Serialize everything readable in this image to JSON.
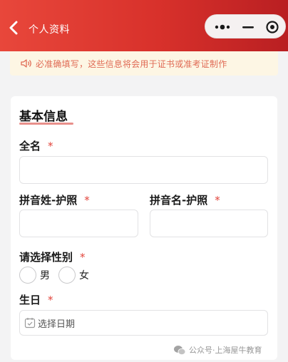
{
  "header": {
    "title": "个人资料",
    "gradient_start": "#e8473b",
    "gradient_end": "#b91f22"
  },
  "capsule": {
    "icons": [
      "more-icon",
      "minimize-icon",
      "close-circle-icon"
    ]
  },
  "notice": {
    "text": "必准确填写，这些信息将会用于证书或准考证制作",
    "icon": "speaker-icon"
  },
  "form": {
    "section_title": "基本信息",
    "required_mark": "*",
    "full_name": {
      "label": "全名",
      "value": ""
    },
    "pinyin_surname": {
      "label": "拼音姓-护照",
      "value": ""
    },
    "pinyin_given": {
      "label": "拼音名-护照",
      "value": ""
    },
    "gender": {
      "label": "请选择性别",
      "options": [
        "男",
        "女"
      ],
      "selected": null
    },
    "birthday": {
      "label": "生日",
      "placeholder": "选择日期",
      "icon": "calendar-icon"
    }
  },
  "watermark": {
    "text": "公众号·上海屋牛教育"
  },
  "colors": {
    "accent": "#e2453c",
    "notice_bg": "#fdf6e4",
    "notice_text": "#e06b55",
    "underline": "#e8908b"
  }
}
